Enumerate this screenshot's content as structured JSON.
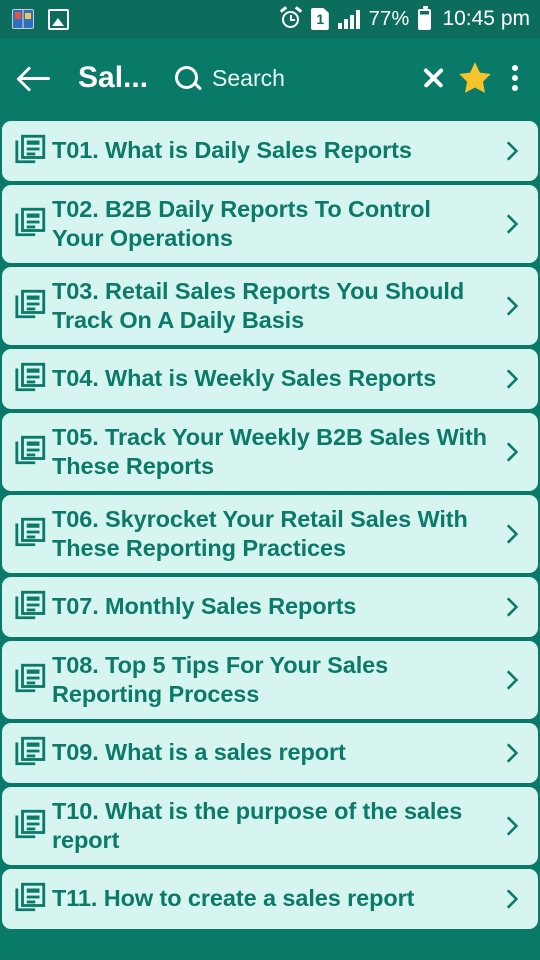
{
  "status_bar": {
    "left_icons": [
      "dictionary-app-icon",
      "screenshot-image-icon"
    ],
    "alarm_icon": "alarm-clock-icon",
    "sim_label": "1",
    "signal_icon": "signal-bars-icon",
    "battery_percent": "77%",
    "battery_icon": "battery-icon",
    "time": "10:45 pm"
  },
  "toolbar": {
    "back_label": "back-arrow",
    "title": "Sal...",
    "search_placeholder": "Search",
    "close_label": "close",
    "star_label": "favorite",
    "more_label": "more options"
  },
  "colors": {
    "toolbar_bg": "#0a7a68",
    "status_bg": "#0c6d5d",
    "card_bg": "#d7f5f0",
    "card_text": "#0c7a68",
    "star": "#f5c32c",
    "white": "#ffffff"
  },
  "list": {
    "items": [
      {
        "label": "T01. What is Daily Sales Reports",
        "lines": 1
      },
      {
        "label": "T02. B2B Daily Reports To Control Your Operations",
        "lines": 2
      },
      {
        "label": "T03. Retail Sales Reports You Should Track On A Daily Basis",
        "lines": 2
      },
      {
        "label": "T04. What is Weekly Sales Reports",
        "lines": 1
      },
      {
        "label": "T05. Track Your Weekly B2B Sales With These Reports",
        "lines": 2
      },
      {
        "label": "T06. Skyrocket Your Retail Sales With These Reporting Practices",
        "lines": 2
      },
      {
        "label": "T07. Monthly Sales Reports",
        "lines": 1
      },
      {
        "label": "T08. Top 5 Tips For Your Sales Reporting Process",
        "lines": 2
      },
      {
        "label": "T09. What is a sales report",
        "lines": 1
      },
      {
        "label": "T10. What is the purpose of the sales report",
        "lines": 2
      },
      {
        "label": "T11. How to create a sales report",
        "lines": 1
      }
    ]
  }
}
